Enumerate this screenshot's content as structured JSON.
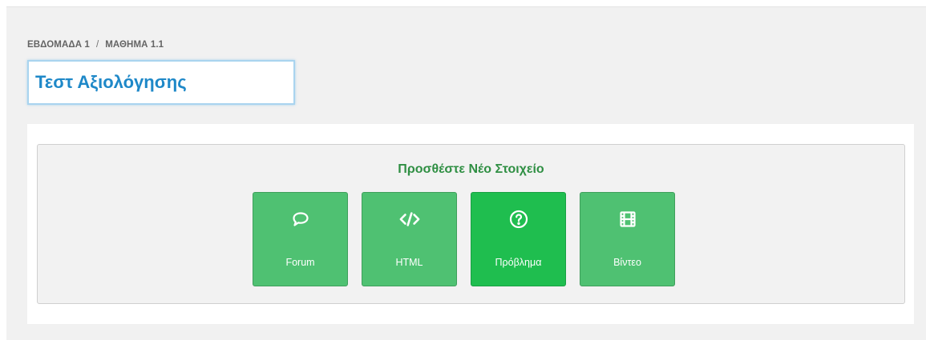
{
  "breadcrumb": {
    "week": "ΕΒΔΟΜΑΔΑ 1",
    "separator": "/",
    "lesson": "ΜΑΘΗΜΑ 1.1"
  },
  "title_input": {
    "value": "Τεστ Αξιολόγησης"
  },
  "new_item": {
    "heading": "Προσθέστε Νέο Στοιχείο",
    "buttons": [
      {
        "label": "Forum",
        "icon": "speech-bubble-icon"
      },
      {
        "label": "HTML",
        "icon": "code-icon"
      },
      {
        "label": "Πρόβλημα",
        "icon": "question-circle-icon"
      },
      {
        "label": "Βίντεο",
        "icon": "film-icon"
      }
    ]
  },
  "colors": {
    "accent_blue": "#1e88c8",
    "heading_green": "#2f8f43",
    "button_green": "#4fc172",
    "button_green_active": "#1fbe4f"
  }
}
